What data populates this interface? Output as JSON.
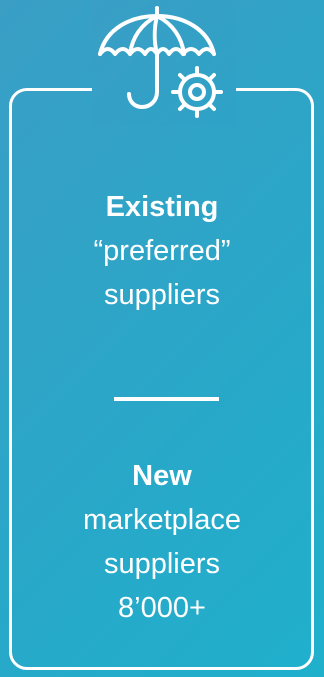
{
  "icon": {
    "name": "umbrella-gear-icon"
  },
  "existing": {
    "heading": "Existing",
    "line1": "“preferred”",
    "line2": "suppliers"
  },
  "new_block": {
    "heading": "New",
    "line1": "marketplace",
    "line2": "suppliers",
    "count": "8’000+"
  },
  "colors": {
    "background_start": "#3a9ec5",
    "background_end": "#1fb0cc",
    "foreground": "#ffffff"
  }
}
